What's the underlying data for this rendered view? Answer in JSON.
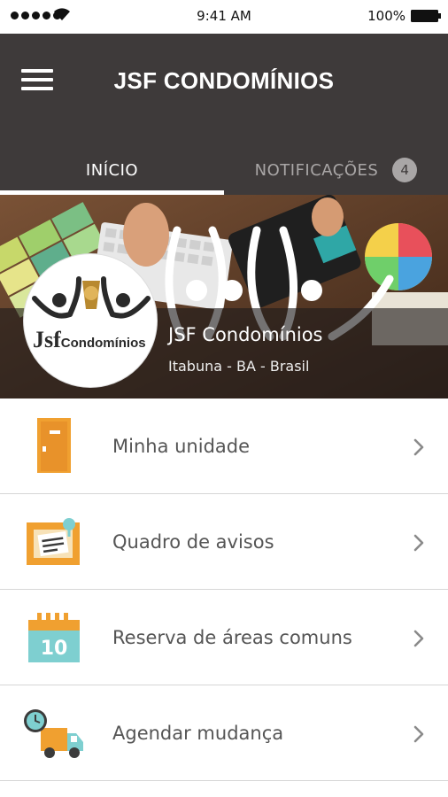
{
  "status_bar": {
    "time": "9:41 AM",
    "battery_percent": "100%"
  },
  "header": {
    "title": "JSF CONDOMÍNIOS",
    "menu_icon": "hamburger-menu-icon"
  },
  "tabs": [
    {
      "label": "INÍCIO",
      "active": true
    },
    {
      "label": "NOTIFICAÇÕES",
      "active": false,
      "badge": "4"
    }
  ],
  "banner": {
    "logo_text_main": "Jsf",
    "logo_text_sub": "Condomínios",
    "condo_name": "JSF Condomínios",
    "location": "Itabuna - BA - Brasil"
  },
  "menu": [
    {
      "label": "Minha unidade",
      "icon": "door-icon"
    },
    {
      "label": "Quadro de avisos",
      "icon": "notice-board-icon"
    },
    {
      "label": "Reserva de áreas comuns",
      "icon": "calendar-icon",
      "icon_text": "10"
    },
    {
      "label": "Agendar mudança",
      "icon": "moving-truck-icon"
    }
  ],
  "colors": {
    "header_bg": "#3e3a3a",
    "accent_orange": "#f0a030",
    "accent_teal": "#7ecfd0",
    "text_gray": "#555555"
  }
}
